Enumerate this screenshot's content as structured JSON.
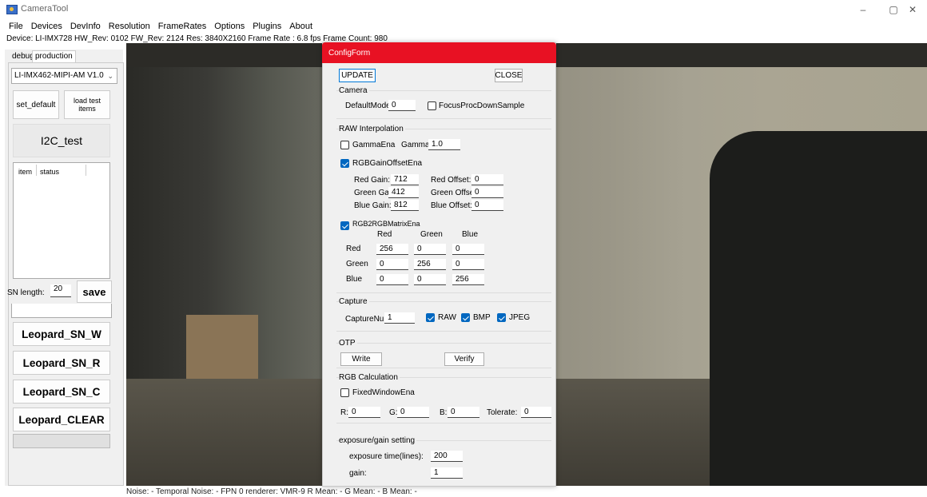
{
  "window": {
    "title": "CameraTool",
    "min": "–",
    "max": "▢",
    "close": "✕"
  },
  "menu": [
    "File",
    "Devices",
    "DevInfo",
    "Resolution",
    "FrameRates",
    "Options",
    "Plugins",
    "About"
  ],
  "devicebar": "Device:  LI-IMX728  HW_Rev:  0102  FW_Rev:  2124  Res:  3840X2160  Frame Rate :  6.8 fps  Frame Count: 980",
  "left": {
    "tabs": [
      "debug",
      "production"
    ],
    "model": "LI-IMX462-MIPI-AM V1.0",
    "set_default": "set_default",
    "load_test": "load test items",
    "i2c_test": "I2C_test",
    "list_headers": [
      "item",
      "status"
    ],
    "sn_length_label": "SN length:",
    "sn_length_value": "20",
    "save": "save",
    "buttons": [
      "Leopard_SN_W",
      "Leopard_SN_R",
      "Leopard_SN_C",
      "Leopard_CLEAR"
    ]
  },
  "statusbar": "Noise:  -  Temporal Noise:  -  FPN  0  renderer:  VMR-9  R Mean:  -  G Mean:  -  B Mean:  -",
  "config": {
    "title": "ConfigForm",
    "update": "UPDATE",
    "close": "CLOSE",
    "camera": {
      "title": "Camera",
      "default_mode_label": "DefaultMode:",
      "default_mode_value": "0",
      "focus_label": "FocusProcDownSample",
      "focus_checked": false
    },
    "raw": {
      "title": "RAW Interpolation",
      "gamma_ena_label": "GammaEna",
      "gamma_ena_checked": false,
      "gamma_label": "Gamma:",
      "gamma_value": "1.0",
      "rgb_gain_offset_label": "RGBGainOffsetEna",
      "rgb_gain_offset_checked": true,
      "red_gain_label": "Red Gain:",
      "red_gain": "712",
      "red_offset_label": "Red Offset:",
      "red_offset": "0",
      "green_gain_label": "Green Gain:",
      "green_gain": "412",
      "green_offset_label": "Green Offset:",
      "green_offset": "0",
      "blue_gain_label": "Blue Gain:",
      "blue_gain": "812",
      "blue_offset_label": "Blue Offset:",
      "blue_offset": "0",
      "matrix_label": "RGB2RGBMatrixEna",
      "matrix_checked": true,
      "matrix_cols": [
        "Red",
        "Green",
        "Blue"
      ],
      "matrix_rows": [
        "Red",
        "Green",
        "Blue"
      ],
      "matrix": [
        [
          "256",
          "0",
          "0"
        ],
        [
          "0",
          "256",
          "0"
        ],
        [
          "0",
          "0",
          "256"
        ]
      ]
    },
    "capture": {
      "title": "Capture",
      "num_label": "CaptureNum:",
      "num_value": "1",
      "raw_label": "RAW",
      "raw_checked": true,
      "bmp_label": "BMP",
      "bmp_checked": true,
      "jpeg_label": "JPEG",
      "jpeg_checked": true
    },
    "otp": {
      "title": "OTP",
      "write": "Write",
      "verify": "Verify"
    },
    "rgbcalc": {
      "title": "RGB Calculation",
      "fixed_label": "FixedWindowEna",
      "fixed_checked": false,
      "r_label": "R:",
      "r_value": "0",
      "g_label": "G:",
      "g_value": "0",
      "b_label": "B:",
      "b_value": "0",
      "tol_label": "Tolerate:",
      "tol_value": "0"
    },
    "exposure": {
      "title": "exposure/gain setting",
      "time_label": "exposure time(lines):",
      "time_value": "200",
      "gain_label": "gain:",
      "gain_value": "1"
    }
  }
}
